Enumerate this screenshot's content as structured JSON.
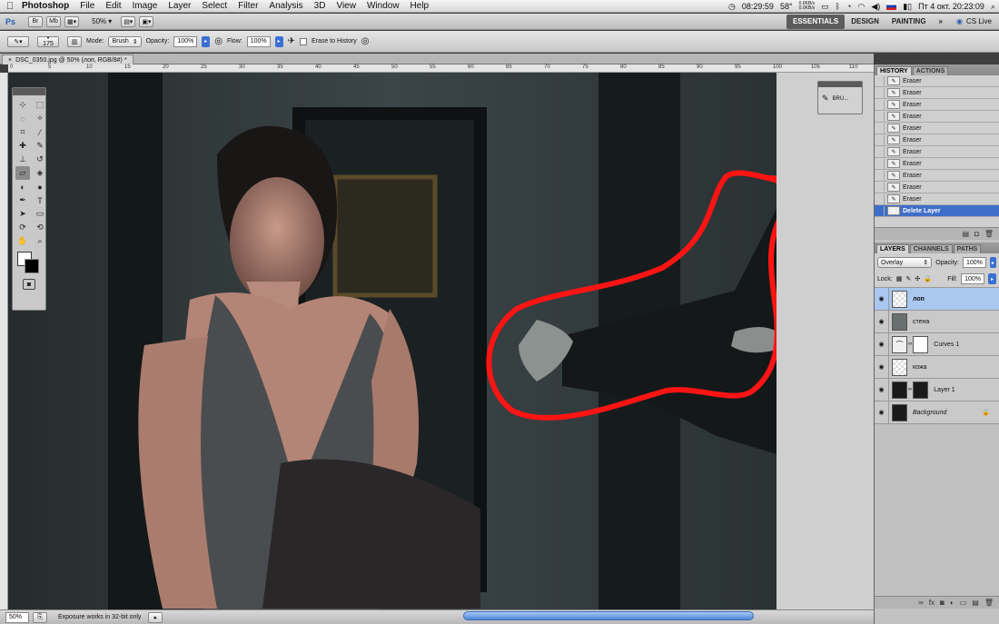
{
  "menubar": {
    "app": "Photoshop",
    "items": [
      "File",
      "Edit",
      "Image",
      "Layer",
      "Select",
      "Filter",
      "Analysis",
      "3D",
      "View",
      "Window",
      "Help"
    ],
    "status": {
      "time1": "08:29:59",
      "temp": "58°",
      "net_up": "0.0KB/s",
      "net_down": "0.0KB/s",
      "date_time": "Пт 4 окт. 20:23:09"
    }
  },
  "appbar": {
    "logo": "Ps",
    "br": "Br",
    "mb": "Mb",
    "zoom": "50%",
    "workspaces": [
      "ESSENTIALS",
      "DESIGN",
      "PAINTING"
    ],
    "more": "»",
    "cslive": "CS Live"
  },
  "options": {
    "brush_size": "175",
    "mode_label": "Mode:",
    "mode_value": "Brush",
    "opacity_label": "Opacity:",
    "opacity_value": "100%",
    "flow_label": "Flow:",
    "flow_value": "100%",
    "erase_history": "Erase to History"
  },
  "document": {
    "tab_title": "DSC_0350.jpg @ 50% (лоп, RGB/8#) *",
    "ruler_ticks": [
      "0",
      "5",
      "10",
      "15",
      "20",
      "25",
      "30",
      "35",
      "40",
      "45",
      "50",
      "55",
      "60",
      "65",
      "70",
      "75",
      "80",
      "85",
      "90",
      "95",
      "100",
      "105",
      "110"
    ]
  },
  "floating_panel": {
    "label": "BRU..."
  },
  "history": {
    "tabs": [
      "HISTORY",
      "ACTIONS"
    ],
    "items": [
      "Eraser",
      "Eraser",
      "Eraser",
      "Eraser",
      "Eraser",
      "Eraser",
      "Eraser",
      "Eraser",
      "Eraser",
      "Eraser",
      "Eraser",
      "Delete Layer"
    ],
    "selected_index": 11
  },
  "layers": {
    "tabs": [
      "LAYERS",
      "CHANNELS",
      "PATHS"
    ],
    "blend_mode": "Overlay",
    "opacity_label": "Opacity:",
    "opacity_value": "100%",
    "lock_label": "Lock:",
    "fill_label": "Fill:",
    "fill_value": "100%",
    "items": [
      {
        "name": "лоп",
        "type": "check",
        "selected": true
      },
      {
        "name": "стена",
        "type": "photo",
        "selected": false
      },
      {
        "name": "Curves 1",
        "type": "curves",
        "selected": false
      },
      {
        "name": "кожа",
        "type": "check",
        "selected": false
      },
      {
        "name": "Layer 1",
        "type": "dark",
        "selected": false
      },
      {
        "name": "Background",
        "type": "dark",
        "selected": false
      }
    ]
  },
  "statusbar": {
    "zoom": "50%",
    "info": "Exposure works in 32-bit only"
  },
  "colors": {
    "annotation_red": "#ff1414",
    "selection_blue": "#3f6ec8",
    "layer_selected": "#a9c7ef"
  }
}
